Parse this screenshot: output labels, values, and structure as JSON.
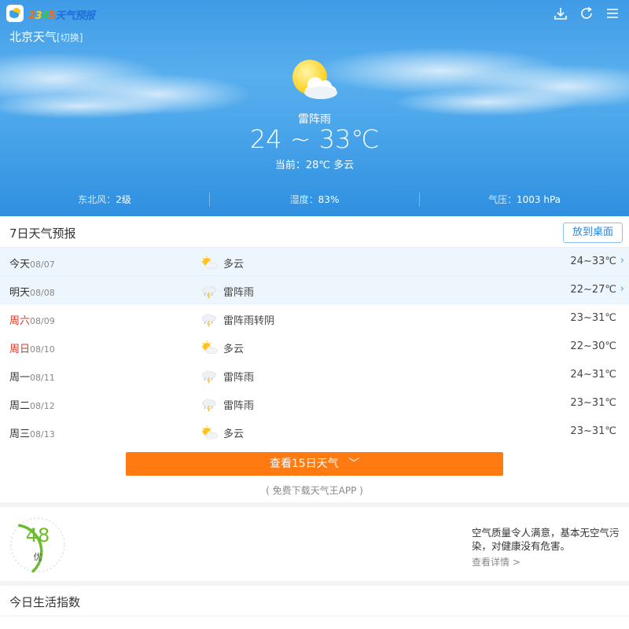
{
  "header": {
    "logo_text": [
      "2",
      "3",
      "4",
      "5",
      "天气预报"
    ],
    "city": "北京天气",
    "switch_label": "[切换]",
    "icons": [
      "download-icon",
      "refresh-icon",
      "menu-icon"
    ]
  },
  "today": {
    "icon": "partly-cloudy-sun-icon",
    "condition": "雷阵雨",
    "temp_range": "24 ~ 33℃",
    "current": "当前：28℃ 多云"
  },
  "stats": [
    {
      "label": "东北风：",
      "value": "2级"
    },
    {
      "label": "湿度：",
      "value": "83%"
    },
    {
      "label": "气压：",
      "value": "1003 hPa"
    }
  ],
  "forecast": {
    "title": "7日天气预报",
    "desktop_button": "放到桌面",
    "days": [
      {
        "name": "今天",
        "date": "08/07",
        "icon": "sun-cloud-icon",
        "condition": "多云",
        "temp": "24~33℃",
        "weekend": false,
        "highlight": true,
        "arrow": "›"
      },
      {
        "name": "明天",
        "date": "08/08",
        "icon": "thunder-rain-icon",
        "condition": "雷阵雨",
        "temp": "22~27℃",
        "weekend": false,
        "highlight": true,
        "arrow": "›"
      },
      {
        "name": "周六",
        "date": "08/09",
        "icon": "thunder-rain-icon",
        "condition": "雷阵雨转阴",
        "temp": "23~31℃",
        "weekend": true,
        "highlight": false,
        "arrow": ""
      },
      {
        "name": "周日",
        "date": "08/10",
        "icon": "sun-cloud-icon",
        "condition": "多云",
        "temp": "22~30℃",
        "weekend": true,
        "highlight": false,
        "arrow": ""
      },
      {
        "name": "周一",
        "date": "08/11",
        "icon": "thunder-rain-icon",
        "condition": "雷阵雨",
        "temp": "24~31℃",
        "weekend": false,
        "highlight": false,
        "arrow": ""
      },
      {
        "name": "周二",
        "date": "08/12",
        "icon": "thunder-rain-icon",
        "condition": "雷阵雨",
        "temp": "23~31℃",
        "weekend": false,
        "highlight": false,
        "arrow": ""
      },
      {
        "name": "周三",
        "date": "08/13",
        "icon": "sun-cloud-icon",
        "condition": "多云",
        "temp": "23~31℃",
        "weekend": false,
        "highlight": false,
        "arrow": ""
      }
    ],
    "more_button": "查看15日天气",
    "more_chevron": "﹀",
    "app_tip": "( 免费下载天气王APP )"
  },
  "aqi": {
    "value": "48",
    "level": "优",
    "fraction": 0.16,
    "color": "#6cbd2b",
    "description": "空气质量令人满意，基本无空气污染，对健康没有危害。",
    "more_link": "查看详情 >"
  },
  "life": {
    "title": "今日生活指数"
  },
  "colors": {
    "accent_orange": "#ff7a10",
    "link_blue": "#2c86de",
    "weekend_red": "#d23a2a"
  }
}
